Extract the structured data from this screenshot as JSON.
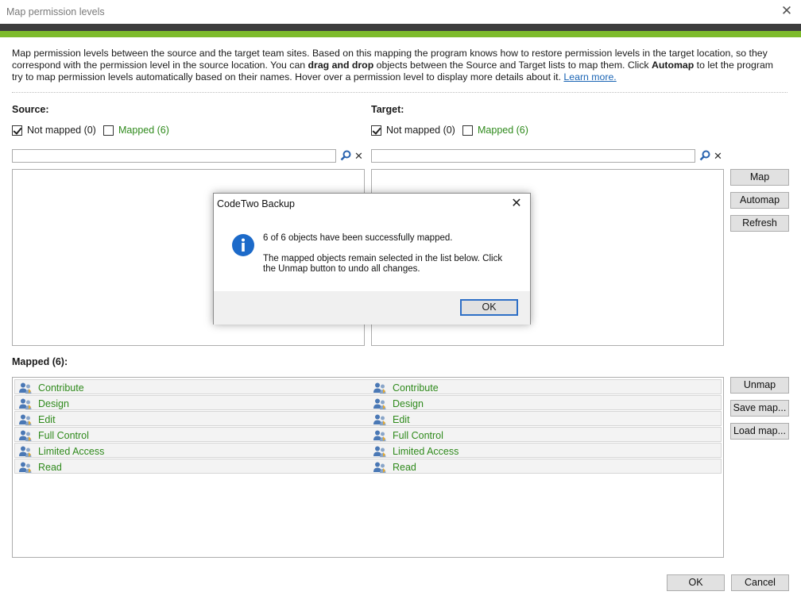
{
  "window": {
    "title": "Map permission levels"
  },
  "description": {
    "part1": "Map permission levels between the source and the target team sites. Based on this mapping the program knows how to restore permission levels in the target location, so they correspond with the permission level in the source location. You can ",
    "bold1": "drag and drop",
    "part2": " objects between the Source and Target lists to map them. Click ",
    "bold2": "Automap",
    "part3": " to let the program try to map permission levels automatically based on their names. Hover over a permission level to display more details about it. ",
    "link": "Learn more."
  },
  "source": {
    "label": "Source:",
    "not_mapped": "Not mapped (0)",
    "mapped": "Mapped (6)",
    "not_mapped_checked": true,
    "mapped_checked": false
  },
  "target": {
    "label": "Target:",
    "not_mapped": "Not mapped (0)",
    "mapped": "Mapped (6)",
    "not_mapped_checked": true,
    "mapped_checked": false
  },
  "buttons": {
    "map": "Map",
    "automap": "Automap",
    "refresh": "Refresh",
    "unmap": "Unmap",
    "save_map": "Save map...",
    "load_map": "Load map...",
    "ok": "OK",
    "cancel": "Cancel"
  },
  "mapped": {
    "label": "Mapped (6):",
    "rows": [
      {
        "source": "Contribute",
        "target": "Contribute"
      },
      {
        "source": "Design",
        "target": "Design"
      },
      {
        "source": "Edit",
        "target": "Edit"
      },
      {
        "source": "Full Control",
        "target": "Full Control"
      },
      {
        "source": "Limited Access",
        "target": "Limited Access"
      },
      {
        "source": "Read",
        "target": "Read"
      }
    ]
  },
  "dialog": {
    "title": "CodeTwo Backup",
    "message1": "6 of 6 objects have been successfully mapped.",
    "message2": "The mapped objects remain selected in the list below. Click the Unmap button to undo all changes.",
    "ok": "OK"
  },
  "colors": {
    "accent_green": "#7dbb2b",
    "header_dark": "#3d3d3d",
    "mapped_text": "#2f8a1c",
    "link": "#1a64b4",
    "dialog_focus": "#2e6fc6"
  }
}
